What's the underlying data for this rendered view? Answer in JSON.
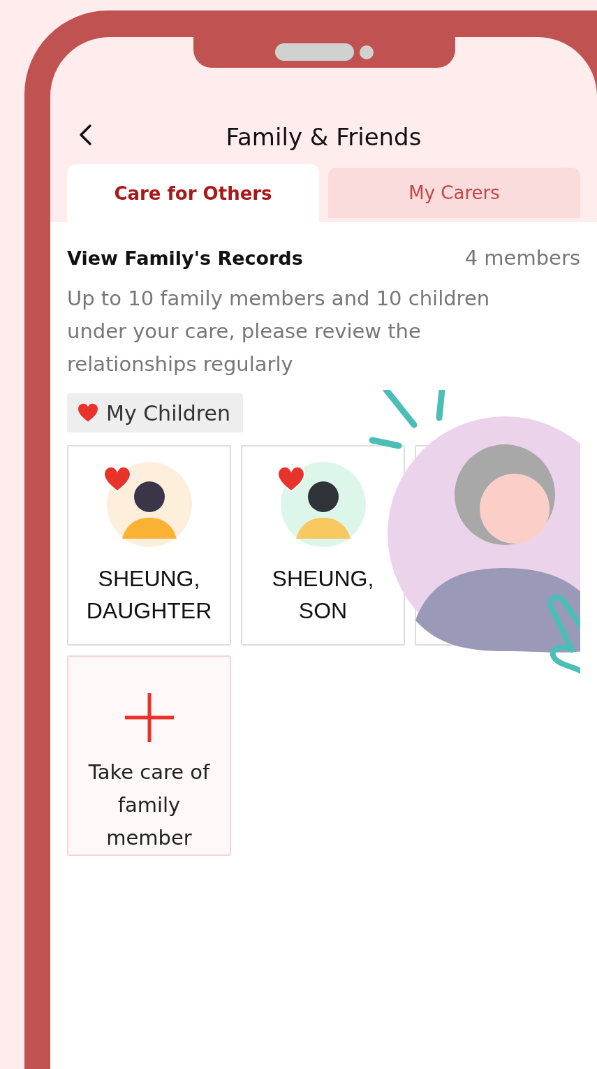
{
  "header": {
    "title": "Family & Friends"
  },
  "tabs": [
    {
      "label": "Care for Others",
      "selected": true
    },
    {
      "label": "My Carers",
      "selected": false
    }
  ],
  "section": {
    "title": "View Family's Records",
    "count": "4 members",
    "description": "Up to 10 family members and 10 children under your care, please review the relationships regularly"
  },
  "filter_tag": {
    "label": "My Children"
  },
  "members": [
    {
      "name": "SHEUNG, DAUGHTER",
      "favorite": true,
      "color": "#fdefdc",
      "kind": "girl"
    },
    {
      "name": "SHEUNG, SON",
      "favorite": true,
      "color": "#dcf7ea",
      "kind": "boy"
    },
    {
      "kind": "hidden"
    }
  ],
  "add_card": {
    "label": "Take care of family member"
  }
}
